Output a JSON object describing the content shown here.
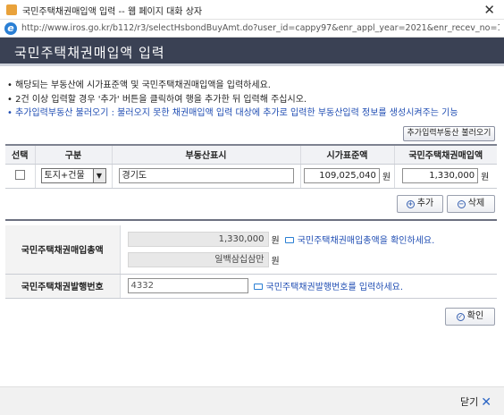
{
  "window": {
    "title": "국민주택채권매입액 입력 -- 웹 페이지 대화 상자",
    "close_glyph": "✕",
    "url": "http://www.iros.go.kr/b112/r3/selectHsbondBuyAmt.do?user_id=cappy97&enr_appl_year=2021&enr_recev_no=1&bond_free_caus_..."
  },
  "header": {
    "title": "국민주택채권매입액 입력"
  },
  "notes": [
    "• 해당되는 부동산에 시가표준액 및 국민주택채권매입액을 입력하세요.",
    "• 2건 이상 입력할 경우 '추가' 버튼을 클릭하여 행을 추가한 뒤 입력해 주십시오.",
    "• 추가입력부동산 불러오기 : 불러오지 못한 채권매입액 입력 대상에 추가로 입력한 부동산입력 정보를 생성시켜주는 기능"
  ],
  "load_button": "추가입력부동산 불러오기",
  "table": {
    "headers": [
      "선택",
      "구분",
      "부동산표시",
      "시가표준액",
      "국민주택채권매입액"
    ],
    "rows": [
      {
        "type": "토지+건물",
        "address": "경기도",
        "standard_price": "109,025,040",
        "bond_amount": "1,330,000",
        "unit": "원"
      }
    ]
  },
  "buttons": {
    "add": "추가",
    "delete": "삭제",
    "confirm": "확인"
  },
  "summary": {
    "total_label": "국민주택채권매입총액",
    "total_value": "1,330,000",
    "total_korean": "일백삼십삼만",
    "unit": "원",
    "total_hint": "국민주택채권매입총액을 확인하세요.",
    "issue_label": "국민주택채권발행번호",
    "issue_value": "4332",
    "issue_hint": "국민주택채권발행번호를 입력하세요."
  },
  "footer": {
    "close": "닫기",
    "close_glyph": "✕"
  }
}
